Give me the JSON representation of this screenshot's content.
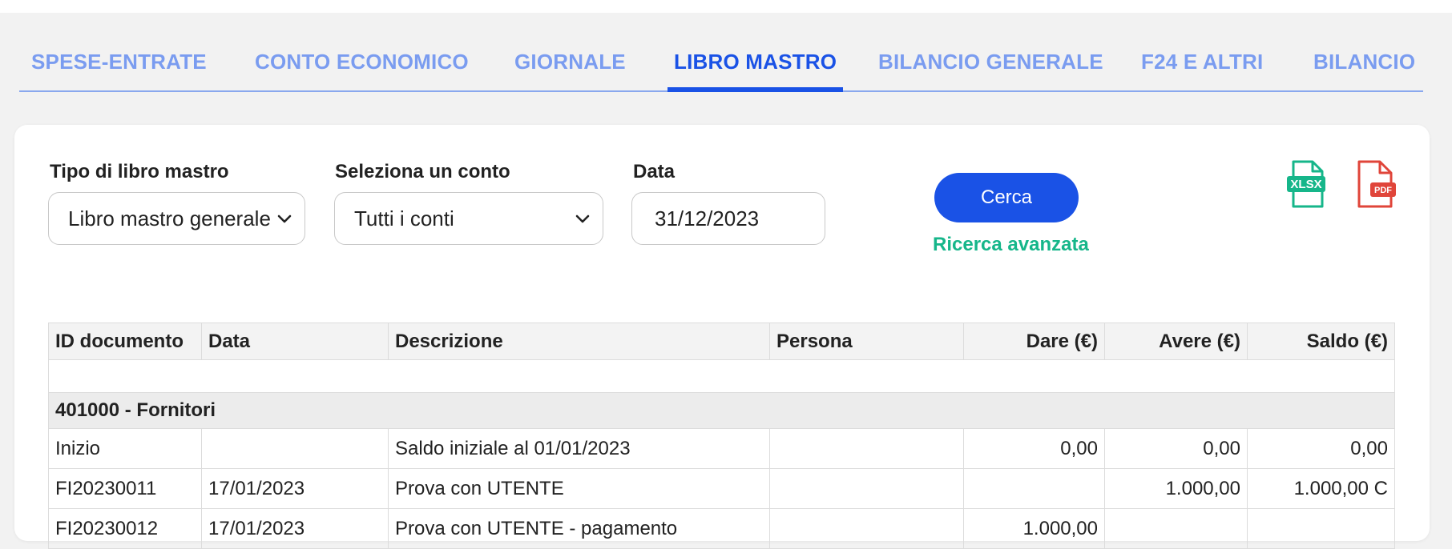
{
  "tabs": [
    {
      "label": "SPESE-ENTRATE",
      "active": false
    },
    {
      "label": "CONTO ECONOMICO",
      "active": false
    },
    {
      "label": "GIORNALE",
      "active": false
    },
    {
      "label": "LIBRO MASTRO",
      "active": true
    },
    {
      "label": "BILANCIO GENERALE",
      "active": false
    },
    {
      "label": "F24 E ALTRI",
      "active": false
    },
    {
      "label": "BILANCIO",
      "active": false
    }
  ],
  "filters": {
    "tipo_label": "Tipo di libro mastro",
    "tipo_value": "Libro mastro generale",
    "conto_label": "Seleziona un conto",
    "conto_value": "Tutti i conti",
    "data_label": "Data",
    "data_value": "31/12/2023"
  },
  "actions": {
    "search_label": "Cerca",
    "advanced_label": "Ricerca avanzata",
    "xlsx_label": "XLSX",
    "pdf_label": "PDF"
  },
  "colors": {
    "accent": "#1a52e6",
    "tab_inactive": "#7a9cf0",
    "advanced_link": "#16b68a",
    "xlsx_icon": "#16b68a",
    "pdf_icon": "#e0453a"
  },
  "table": {
    "columns": [
      "ID documento",
      "Data",
      "Descrizione",
      "Persona",
      "Dare (€)",
      "Avere (€)",
      "Saldo (€)"
    ],
    "group": "401000 - Fornitori",
    "rows": [
      [
        "Inizio",
        "",
        "Saldo iniziale al 01/01/2023",
        "",
        "0,00",
        "0,00",
        "0,00"
      ],
      [
        "FI20230011",
        "17/01/2023",
        "Prova con UTENTE",
        "",
        "",
        "1.000,00",
        "1.000,00 C"
      ],
      [
        "FI20230012",
        "17/01/2023",
        "Prova con UTENTE - pagamento",
        "",
        "1.000,00",
        "",
        ""
      ]
    ]
  }
}
